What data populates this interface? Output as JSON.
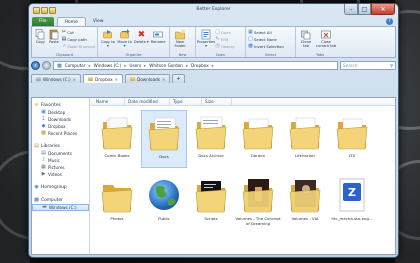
{
  "window": {
    "title": "Better Explorer"
  },
  "ribbon": {
    "tabs": [
      {
        "label": "File"
      },
      {
        "label": "Home"
      },
      {
        "label": "View"
      }
    ],
    "groups": {
      "clipboard": {
        "label": "Clipboard",
        "copy": "Copy",
        "paste": "Paste",
        "cut": "Cut",
        "copy_path": "Copy path",
        "paste_shortcut": "Paste Shortcut"
      },
      "organize": {
        "label": "Organize",
        "copy_to": "Copy to ▾",
        "move_to": "Move to ▾",
        "delete": "Delete ▾",
        "rename": "Rename"
      },
      "new": {
        "label": "New",
        "new_folder": "New Folder"
      },
      "open": {
        "label": "Open",
        "properties": "Properties ▾",
        "open": "Open",
        "edit": "Edit",
        "history": "History"
      },
      "select": {
        "label": "Select",
        "select_all": "Select All",
        "select_none": "Select None",
        "invert_selection": "Invert Selection"
      },
      "tabs": {
        "label": "Tabs",
        "clone_tab": "Clone tab",
        "close_current_tab": "Close current tab"
      }
    }
  },
  "address": {
    "crumbs": [
      "Computer",
      "Windows (C:)",
      "Users",
      "Whitson Gordon",
      "Dropbox"
    ],
    "search_placeholder": "Search"
  },
  "tabs": [
    {
      "label": "Windows (C:)",
      "active": false
    },
    {
      "label": "Dropbox",
      "active": true
    },
    {
      "label": "Downloads",
      "active": false
    }
  ],
  "columns": [
    "Name",
    "Date modified",
    "Type",
    "Size"
  ],
  "nav": {
    "favorites": {
      "label": "Favorites",
      "items": [
        "Desktop",
        "Downloads",
        "Dropbox",
        "Recent Places"
      ]
    },
    "libraries": {
      "label": "Libraries",
      "items": [
        "Documents",
        "Music",
        "Pictures",
        "Videos"
      ]
    },
    "homegroup": "Homegroup",
    "computer": {
      "label": "Computer",
      "items": [
        "Windows (C:)"
      ]
    }
  },
  "files": [
    {
      "name": "Comic Books",
      "icon": "folder-icon"
    },
    {
      "name": "Docs",
      "icon": "folder-docs-icon"
    },
    {
      "name": "Docs Archive",
      "icon": "folder-docs-archive-icon"
    },
    {
      "name": "Gordon",
      "icon": "folder-icon"
    },
    {
      "name": "Lifehacker",
      "icon": "folder-icon"
    },
    {
      "name": "LTS",
      "icon": "folder-icon"
    },
    {
      "name": "Photos",
      "icon": "folder-icon"
    },
    {
      "name": "Public",
      "icon": "globe-icon"
    },
    {
      "name": "Scripts",
      "icon": "folder-scripts-icon"
    },
    {
      "name": "Volumes - The Concept of Dreaming",
      "icon": "folder-image-icon"
    },
    {
      "name": "Volumes - VIA",
      "icon": "folder-image-icon"
    },
    {
      "name": "htc_mecha-sta-eng...",
      "icon": "zip-icon"
    }
  ],
  "colors": {
    "accent": "#3c7ed2",
    "folder": "#e8c25a",
    "file_tab": "#3e8e3a",
    "close": "#c2402a"
  }
}
